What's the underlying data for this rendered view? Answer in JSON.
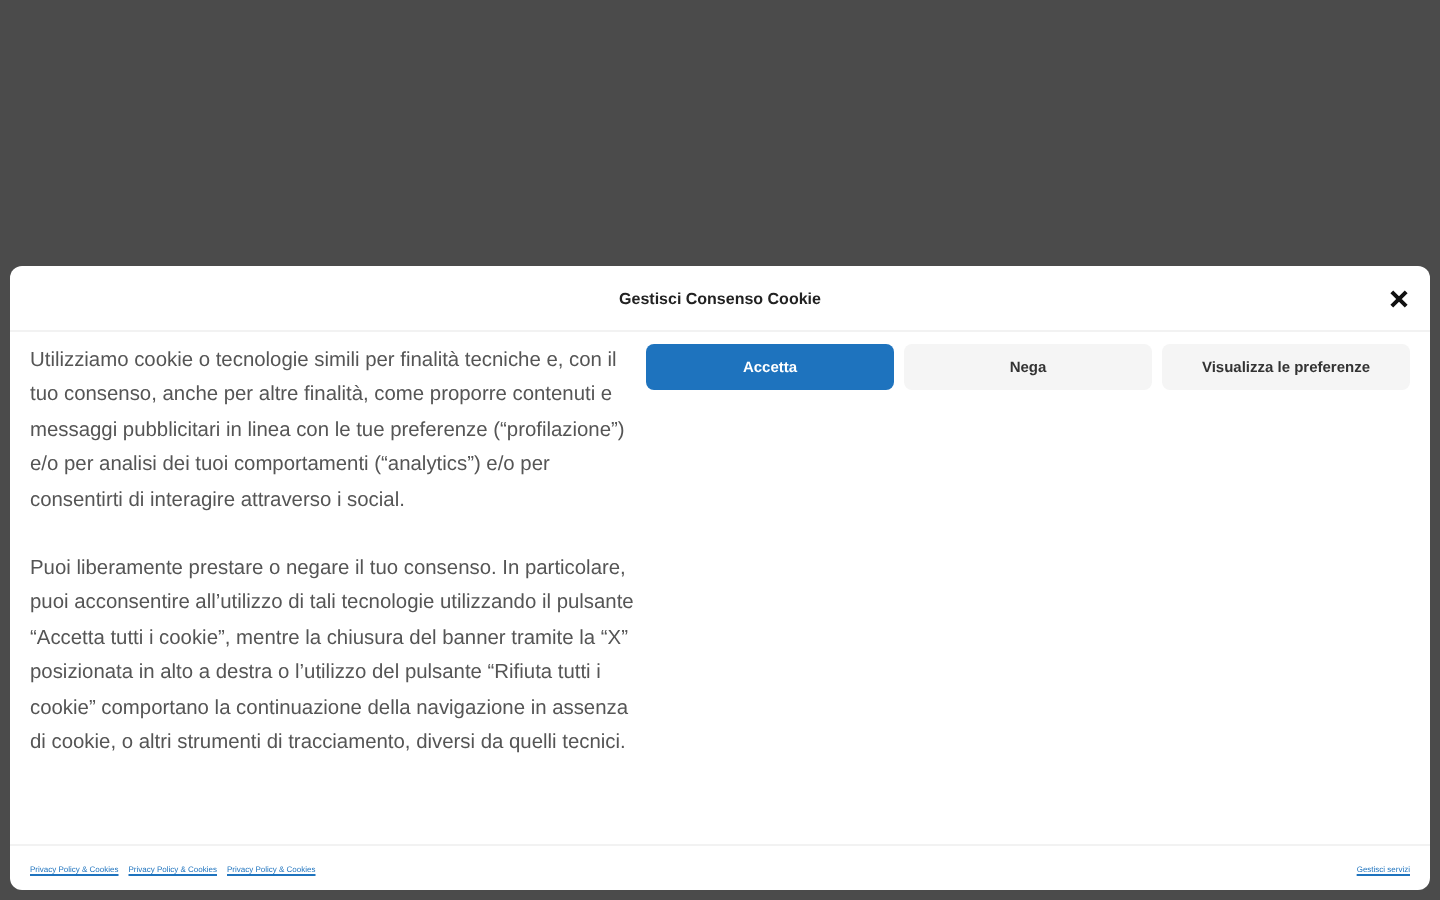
{
  "dialog": {
    "title": "Gestisci Consenso Cookie",
    "paragraphs": [
      "Utilizziamo cookie o tecnologie simili per finalità tecniche e, con il tuo consenso, anche per altre finalità, come proporre contenuti e messaggi pubblicitari in linea con le tue preferenze (“profilazione”) e/o per analisi dei tuoi comportamenti (“analytics”) e/o per consentirti di interagire attraverso i social.",
      "Puoi liberamente prestare o negare il tuo consenso. In particolare, puoi acconsentire all’utilizzo di tali tecnologie utilizzando il pulsante “Accetta tutti i cookie”, mentre la chiusura del banner tramite la “X” posizionata in alto a destra o l’utilizzo del pulsante “Rifiuta tutti i cookie” comportano la continuazione della navigazione in assenza di cookie, o altri strumenti di tracciamento, diversi da quelli tecnici."
    ],
    "buttons": [
      {
        "label": "Accetta",
        "kind": "primary"
      },
      {
        "label": "Nega",
        "kind": "secondary"
      },
      {
        "label": "Visualizza le preferenze",
        "kind": "secondary"
      }
    ],
    "footer_links": [
      "Privacy Policy & Cookies",
      "Privacy Policy & Cookies",
      "Privacy Policy & Cookies"
    ],
    "footer_right": "Gestisci servizi"
  }
}
